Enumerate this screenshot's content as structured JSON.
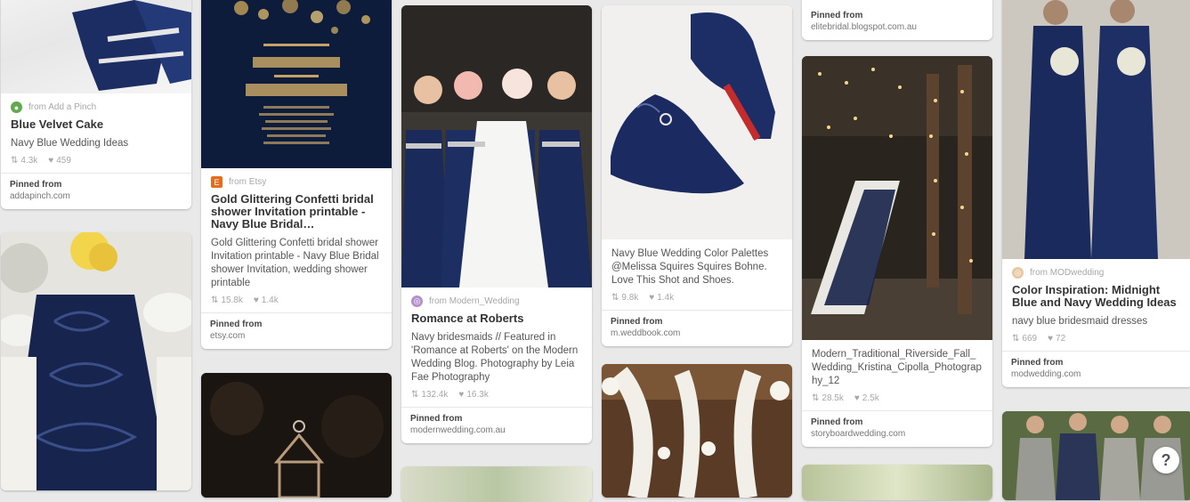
{
  "pins": [
    {
      "source": "from Add a Pinch",
      "title": "Blue Velvet Cake",
      "desc": "Navy Blue Wedding Ideas",
      "repins": "4.3k",
      "likes": "459",
      "pinned_from": "Pinned from",
      "domain": "addapinch.com"
    },
    {
      "source": "from Etsy",
      "title": "Gold Glittering Confetti bridal shower Invitation printable - Navy Blue Bridal…",
      "desc": "Gold Glittering Confetti bridal shower Invitation printable - Navy Blue Bridal shower Invitation, wedding shower printable",
      "repins": "15.8k",
      "likes": "1.4k",
      "pinned_from": "Pinned from",
      "domain": "etsy.com"
    },
    {
      "source": "from Modern_Wedding",
      "title": "Romance at Roberts",
      "desc": "Navy bridesmaids // Featured in 'Romance at Roberts' on the Modern Wedding Blog. Photography by Leia Fae Photography",
      "repins": "132.4k",
      "likes": "16.3k",
      "pinned_from": "Pinned from",
      "domain": "modernwedding.com.au"
    },
    {
      "desc": "Navy Blue Wedding Color Palettes @Melissa Squires Squires Bohne. Love This Shot and Shoes.",
      "repins": "9.8k",
      "likes": "1.4k",
      "pinned_from": "Pinned from",
      "domain": "m.weddbook.com"
    },
    {
      "pinned_from": "Pinned from",
      "domain": "elitebridal.blogspot.com.au"
    },
    {
      "desc": "Modern_Traditional_Riverside_Fall_Wedding_Kristina_Cipolla_Photography_12",
      "repins": "28.5k",
      "likes": "2.5k",
      "pinned_from": "Pinned from",
      "domain": "storyboardwedding.com"
    },
    {
      "source": "from MODwedding",
      "title": "Color Inspiration: Midnight Blue and Navy Wedding Ideas",
      "desc": "navy blue bridesmaid dresses",
      "repins": "669",
      "likes": "72",
      "pinned_from": "Pinned from",
      "domain": "modwedding.com"
    }
  ],
  "icons": {
    "repin": "repin-icon",
    "like": "heart-icon",
    "help": "question-icon"
  },
  "help_label": "?",
  "colors": {
    "navy": "#1b2a52",
    "etsy": "#e36d1c",
    "addapinch": "#5fa94f",
    "modern": "#b48fca",
    "modwedding": "#e8c7a3"
  }
}
